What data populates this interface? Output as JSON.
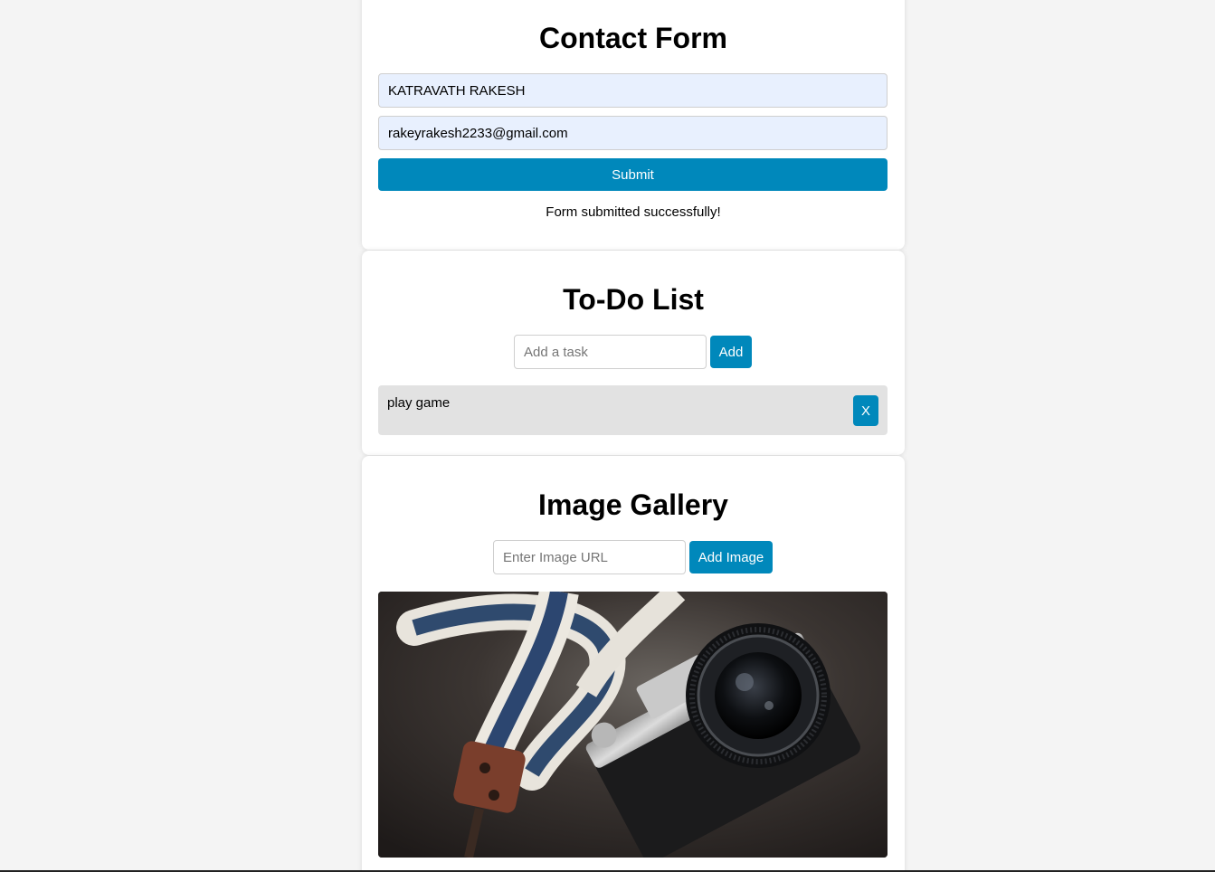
{
  "contact_form": {
    "title": "Contact Form",
    "name_value": "KATRAVATH RAKESH",
    "email_value": "rakeyrakesh2233@gmail.com",
    "submit_label": "Submit",
    "status_message": "Form submitted successfully!"
  },
  "todo": {
    "title": "To-Do List",
    "input_placeholder": "Add a task",
    "add_label": "Add",
    "items": [
      {
        "text": "play game",
        "remove_label": "X"
      }
    ]
  },
  "gallery": {
    "title": "Image Gallery",
    "url_placeholder": "Enter Image URL",
    "add_label": "Add Image",
    "images": [
      {
        "subject": "camera-with-strap-photo"
      }
    ]
  },
  "colors": {
    "accent": "#0088bb",
    "page_background": "#f4f4f4",
    "autofill_background": "#e8f0fe",
    "todo_item_background": "#e2e2e2"
  }
}
